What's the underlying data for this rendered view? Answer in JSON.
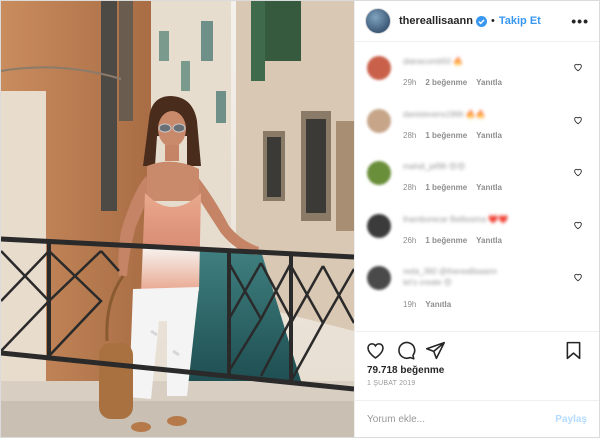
{
  "header": {
    "username": "thereallisaann",
    "follow_label": "Takip Et",
    "separator": "•"
  },
  "comments": [
    {
      "text": "dianacomb50 🔥",
      "age": "29h",
      "likes": "2 beğenme",
      "reply": "Yanıtla",
      "avatar_color": "#c9604a"
    },
    {
      "text": "danistevens1966 🔥🔥",
      "age": "28h",
      "likes": "1 beğenme",
      "reply": "Yanıtla",
      "avatar_color": "#c7a589"
    },
    {
      "text": "mahdi_jaf96 😍😍",
      "age": "28h",
      "likes": "1 beğenme",
      "reply": "Yanıtla",
      "avatar_color": "#6a8f3a"
    },
    {
      "text": "thamborecar Bellissima ❤️❤️",
      "age": "26h",
      "likes": "1 beğenme",
      "reply": "Yanıtla",
      "avatar_color": "#3b3b3b"
    },
    {
      "text": "reda_360 @thereallisaann let's create 😍",
      "age": "19h",
      "likes": "",
      "reply": "Yanıtla",
      "avatar_color": "#4a4a4a"
    }
  ],
  "likes_count": "79.718 beğenme",
  "post_date": "1 ŞUBAT 2019",
  "add_comment": {
    "placeholder": "Yorum ekle...",
    "share_label": "Paylaş"
  },
  "colors": {
    "link_blue": "#3897f0",
    "share_disabled": "#b3dbff",
    "meta_gray": "#8e8e8e"
  }
}
